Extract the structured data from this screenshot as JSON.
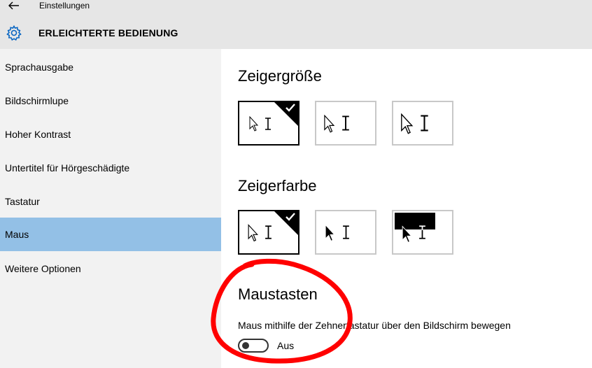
{
  "window": {
    "title": "Einstellungen"
  },
  "header": {
    "section": "ERLEICHTERTE BEDIENUNG"
  },
  "sidebar": {
    "items": [
      {
        "label": "Sprachausgabe"
      },
      {
        "label": "Bildschirmlupe"
      },
      {
        "label": "Hoher Kontrast"
      },
      {
        "label": "Untertitel für Hörgeschädigte"
      },
      {
        "label": "Tastatur"
      },
      {
        "label": "Maus"
      },
      {
        "label": "Weitere Optionen"
      }
    ],
    "active": "Maus"
  },
  "pointer_size": {
    "heading": "Zeigergröße",
    "options": [
      "small",
      "medium",
      "large"
    ],
    "selected": "small"
  },
  "pointer_color": {
    "heading": "Zeigerfarbe",
    "options": [
      "white",
      "black",
      "inverted"
    ],
    "selected": "white"
  },
  "mouse_keys": {
    "heading": "Maustasten",
    "description": "Maus mithilfe der Zehnertastatur über den Bildschirm bewegen",
    "toggle_state": "Aus"
  },
  "colors": {
    "titlebar": "#e6e6e6",
    "sidebar": "#f2f2f2",
    "active_item": "#93c0e6",
    "accent_icon": "#0a66c2",
    "annotation": "#ff0000"
  },
  "icons": [
    "back-arrow-icon",
    "gear-icon",
    "check-icon",
    "arrow-cursor-icon",
    "ibeam-cursor-icon"
  ]
}
